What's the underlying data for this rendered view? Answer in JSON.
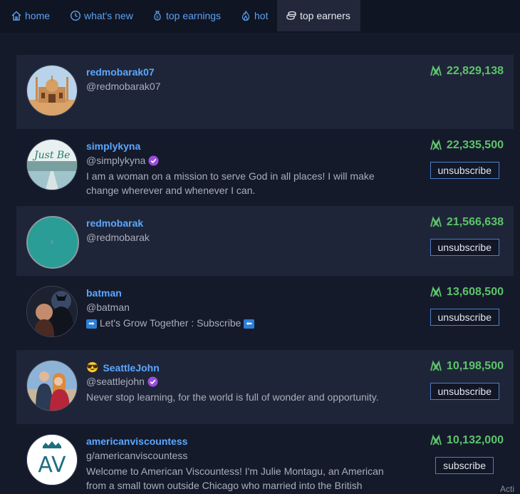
{
  "nav": {
    "tabs": [
      {
        "label": "home",
        "icon": "home-icon"
      },
      {
        "label": "what's new",
        "icon": "clock-icon"
      },
      {
        "label": "top earnings",
        "icon": "money-bag-icon"
      },
      {
        "label": "hot",
        "icon": "flame-icon"
      },
      {
        "label": "top earners",
        "icon": "coins-icon",
        "active": true
      }
    ]
  },
  "colors": {
    "accent": "#5aa8ff",
    "earnings": "#5cc46a",
    "background": "#151a2b",
    "row_alt": "#1f2538",
    "verified": "#9b4de0"
  },
  "earners": [
    {
      "name": "redmobarak07",
      "handle": "@redmobarak07",
      "bio": "",
      "earnings": "22,829,138",
      "verified": false,
      "action": ""
    },
    {
      "name": "simplykyna",
      "handle": "@simplykyna",
      "bio": "I am a woman on a mission to serve God in all places! I will make change wherever and whenever I can.",
      "earnings": "22,335,500",
      "verified": true,
      "action": "unsubscribe"
    },
    {
      "name": "redmobarak",
      "handle": "@redmobarak",
      "bio": "",
      "earnings": "21,566,638",
      "verified": false,
      "action": "unsubscribe"
    },
    {
      "name": "batman",
      "handle": "@batman",
      "bio": "Let's Grow Together : Subscribe",
      "earnings": "13,608,500",
      "verified": false,
      "action": "unsubscribe"
    },
    {
      "name": "SeattleJohn",
      "handle": "@seattlejohn",
      "bio": "Never stop learning, for the world is full of wonder and opportunity.",
      "earnings": "10,198,500",
      "verified": true,
      "action": "unsubscribe"
    },
    {
      "name": "americanviscountess",
      "handle": "g/americanviscountess",
      "bio": "Welcome to American Viscountess! I'm Julie Montagu, an American from a small town outside Chicago who married into the British",
      "earnings": "10,132,000",
      "verified": false,
      "action": "subscribe"
    }
  ],
  "avatars": {
    "av_initials": "AV"
  },
  "misc": {
    "corner": "Acti"
  }
}
